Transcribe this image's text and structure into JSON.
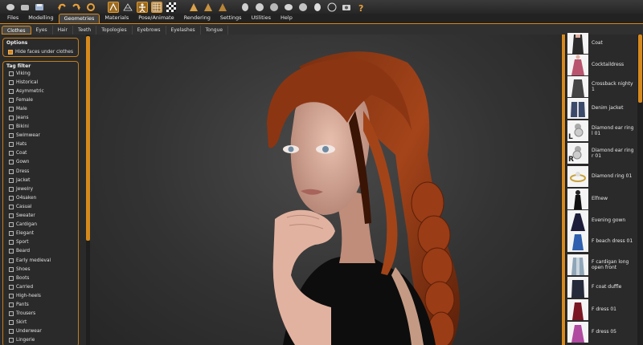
{
  "toolbar": {
    "icons": [
      "file-icon",
      "model-icon",
      "save-icon",
      "undo-icon",
      "redo-icon",
      "reset-icon",
      "smooth-icon",
      "wireframe-icon",
      "pose-icon",
      "grid-icon",
      "checker-icon",
      "front-view-icon",
      "side-view-icon",
      "top-view-icon",
      "sphere1-icon",
      "sphere2-icon",
      "sphere3-icon",
      "sphere4-icon",
      "sphere5-icon",
      "sphere6-icon",
      "circle-icon",
      "camera-icon",
      "help-icon"
    ]
  },
  "main_tabs": [
    "Files",
    "Modelling",
    "Geometries",
    "Materials",
    "Pose/Animate",
    "Rendering",
    "Settings",
    "Utilities",
    "Help"
  ],
  "main_active": "Geometries",
  "sub_tabs": [
    "Clothes",
    "Eyes",
    "Hair",
    "Teeth",
    "Topologies",
    "Eyebrows",
    "Eyelashes",
    "Tongue"
  ],
  "sub_active": "Clothes",
  "options": {
    "title": "Options",
    "hide_faces_label": "Hide faces under clothes",
    "hide_faces_checked": true
  },
  "tag_filter": {
    "title": "Tag filter",
    "tags": [
      "Viking",
      "Historical",
      "Asymmetric",
      "Female",
      "Male",
      "Jeans",
      "Bikini",
      "Swimwear",
      "Hats",
      "Coat",
      "Gown",
      "Dress",
      "Jacket",
      "Jewelry",
      "O4saken",
      "Casual",
      "Sweater",
      "Cardigan",
      "Elegant",
      "Sport",
      "Beard",
      "Early medieval",
      "Shoes",
      "Boots",
      "Carried",
      "High-heels",
      "Pants",
      "Trousers",
      "Skirt",
      "Underwear",
      "Lingerie"
    ]
  },
  "clothes_list": [
    {
      "label": "Coat",
      "thumb": "coat"
    },
    {
      "label": "Cocktaildress",
      "thumb": "dress-pink"
    },
    {
      "label": "Crossback nighty 1",
      "thumb": "nighty"
    },
    {
      "label": "Denim jacket",
      "thumb": "jacket"
    },
    {
      "label": "Diamond ear ring l 01",
      "thumb": "earring-l"
    },
    {
      "label": "Diamond ear ring r 01",
      "thumb": "earring-r"
    },
    {
      "label": "Diamond ring 01",
      "thumb": "ring"
    },
    {
      "label": "Elfnew",
      "thumb": "elf"
    },
    {
      "label": "Evening gown",
      "thumb": "gown"
    },
    {
      "label": "F beach dress 01",
      "thumb": "beach"
    },
    {
      "label": "F cardigan long open front",
      "thumb": "cardigan"
    },
    {
      "label": "F coat duffle",
      "thumb": "duffle"
    },
    {
      "label": "F dress 01",
      "thumb": "dress-red"
    },
    {
      "label": "F dress 05",
      "thumb": "dress-purple"
    }
  ],
  "earring_marks": {
    "left": "L",
    "right": "R"
  },
  "colors": {
    "accent": "#d88a1c",
    "panel": "#2a2a2a"
  }
}
